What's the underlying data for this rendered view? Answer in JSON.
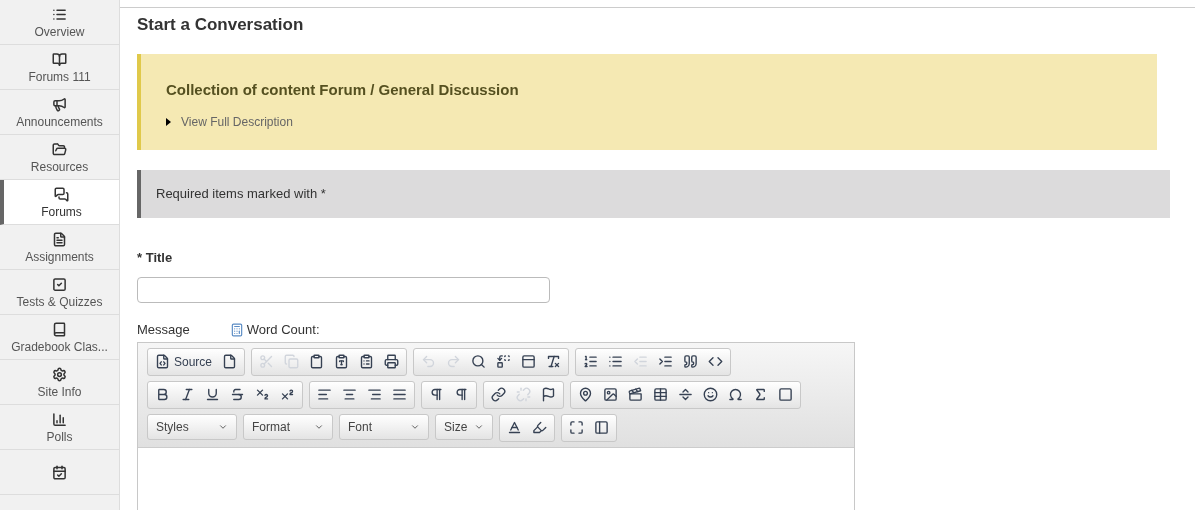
{
  "sidebar": {
    "items": [
      {
        "label": "Overview",
        "selected": false
      },
      {
        "label": "Forums 111",
        "selected": false
      },
      {
        "label": "Announcements",
        "selected": false
      },
      {
        "label": "Resources",
        "selected": false
      },
      {
        "label": "Forums",
        "selected": true
      },
      {
        "label": "Assignments",
        "selected": false
      },
      {
        "label": "Tests & Quizzes",
        "selected": false
      },
      {
        "label": "Gradebook Clas...",
        "selected": false
      },
      {
        "label": "Site Info",
        "selected": false
      },
      {
        "label": "Polls",
        "selected": false
      },
      {
        "selected": false
      }
    ]
  },
  "page_title": "Start a Conversation",
  "forum_box": {
    "title": "Collection of content Forum / General Discussion",
    "link": "View Full Description",
    "expanded": false
  },
  "notice": "Required items marked with *",
  "title_field": {
    "required_mark": "*",
    "label": "Title"
  },
  "message": {
    "label": "Message",
    "word_count": "Word Count:"
  },
  "toolbar": {
    "rows": [
      [
        [
          {
            "label": "Source",
            "disabled": false
          },
          {
            "disabled": false
          }
        ],
        [
          {
            "disabled": true
          },
          {
            "disabled": true
          },
          {
            "disabled": false
          },
          {
            "disabled": false
          },
          {
            "disabled": false
          },
          {
            "disabled": false
          }
        ],
        [
          {
            "disabled": true
          },
          {
            "disabled": true
          },
          {
            "disabled": false
          },
          {
            "disabled": false
          },
          {
            "disabled": false
          },
          {
            "disabled": false
          }
        ],
        [
          {
            "disabled": false
          },
          {
            "disabled": false
          },
          {
            "disabled": true
          },
          {
            "disabled": false
          },
          {
            "disabled": false
          },
          {
            "disabled": false
          }
        ]
      ],
      [
        [
          {
            "disabled": false
          },
          {
            "disabled": false
          },
          {
            "disabled": false
          },
          {
            "disabled": false
          },
          {
            "disabled": false
          },
          {
            "disabled": false
          }
        ],
        [
          {
            "disabled": false
          },
          {
            "disabled": false
          },
          {
            "disabled": false
          },
          {
            "disabled": false
          }
        ],
        [
          {
            "disabled": false
          },
          {
            "disabled": false
          }
        ],
        [
          {
            "disabled": false
          },
          {
            "disabled": true
          },
          {
            "disabled": false
          }
        ],
        [
          {
            "disabled": false
          },
          {
            "disabled": false
          },
          {
            "disabled": false
          },
          {
            "disabled": false
          },
          {
            "disabled": false
          },
          {
            "disabled": false
          },
          {
            "disabled": false
          },
          {
            "disabled": false
          },
          {
            "disabled": false
          }
        ]
      ]
    ],
    "combos": [
      "Styles",
      "Format",
      "Font",
      "Size"
    ],
    "color_buttons": [
      {
        "disabled": false
      },
      {
        "disabled": false
      }
    ],
    "tools": [
      {
        "disabled": false
      },
      {
        "disabled": false
      }
    ]
  }
}
